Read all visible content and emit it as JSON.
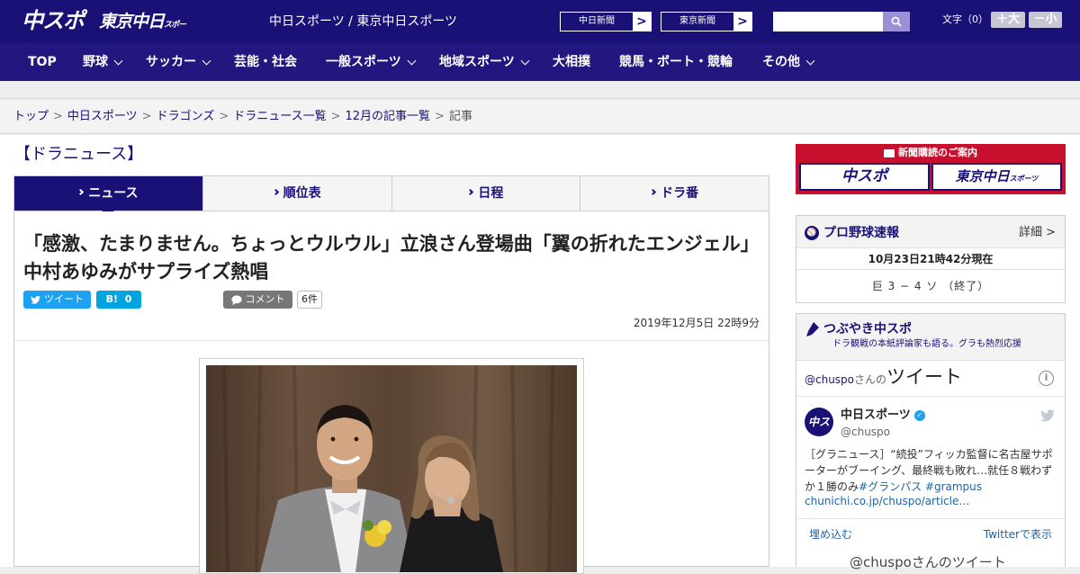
{
  "header": {
    "logo_chunichi": "中スポ",
    "logo_tokyo": "東京中日",
    "logo_tokyo_small": "スポーツ",
    "site_title": "中日スポーツ / 東京中日スポーツ",
    "ext_links": [
      {
        "label": "中日新聞",
        "arrow": ">"
      },
      {
        "label": "東京新聞",
        "arrow": ">"
      }
    ],
    "search_placeholder": "",
    "fontsize_label": "文字（0）",
    "font_larger": "＋大",
    "font_smaller": "－小"
  },
  "nav": [
    {
      "label": "TOP",
      "dropdown": false
    },
    {
      "label": "野球",
      "dropdown": true
    },
    {
      "label": "サッカー",
      "dropdown": true
    },
    {
      "label": "芸能・社会",
      "dropdown": false
    },
    {
      "label": "一般スポーツ",
      "dropdown": true
    },
    {
      "label": "地域スポーツ",
      "dropdown": true
    },
    {
      "label": "大相撲",
      "dropdown": false
    },
    {
      "label": "競馬・ボート・競輪",
      "dropdown": false
    },
    {
      "label": "その他",
      "dropdown": true
    }
  ],
  "breadcrumb": [
    {
      "label": "トップ",
      "link": true
    },
    {
      "label": "中日スポーツ",
      "link": true
    },
    {
      "label": "ドラゴンズ",
      "link": true
    },
    {
      "label": "ドラニュース一覧",
      "link": true
    },
    {
      "label": "12月の記事一覧",
      "link": true
    },
    {
      "label": "記事",
      "link": false
    }
  ],
  "breadcrumb_sep": ">",
  "section_title": "【ドラニュース】",
  "tabs": [
    {
      "label": "ニュース",
      "active": true
    },
    {
      "label": "順位表",
      "active": false
    },
    {
      "label": "日程",
      "active": false
    },
    {
      "label": "ドラ番",
      "active": false
    }
  ],
  "article": {
    "headline": "「感激、たまりません。ちょっとウルウル」立浪さん登場曲「翼の折れたエンジェル」中村あゆみがサプライズ熱唱",
    "tweet_label": "ツイート",
    "hatena_label": "B!",
    "hatena_count": "0",
    "comment_label": "コメント",
    "comment_count": "6件",
    "pubdate": "2019年12月5日 22時9分"
  },
  "sidebar": {
    "ad": {
      "title": "新聞購読のご案内",
      "logo1": "中スポ",
      "logo2": "東京中日",
      "logo2_small": "スポーツ"
    },
    "baseball": {
      "title": "プロ野球速報",
      "more": "詳細 >",
      "time": "10月23日21時42分現在",
      "score": "巨 3 − 4 ソ （終了）"
    },
    "tsubuyaki": {
      "title": "つぶやき中スポ",
      "subtitle": "ドラ観戦の本紙評論家も語る。グラも熱烈応援",
      "timeline_handle": "@chuspo",
      "timeline_san": "さんの",
      "timeline_word": "ツイート",
      "info": "i",
      "account_name": "中日スポーツ",
      "account_handle": "@chuspo",
      "avatar_text": "中スポ",
      "tweet_text": "［グラニュース］“続投”フィッカ監督に名古屋サポーターがブーイング、最終戦も敗れ…就任８戦わずか１勝のみ",
      "tweet_tag1": "#グランパス",
      "tweet_tag2": "#grampus",
      "tweet_link": "chunichi.co.jp/chuspo/article…",
      "embed": "埋め込む",
      "view_on_twitter": "Twitterで表示",
      "bottom_text": "@chuspoさんのツイート"
    }
  },
  "colors": {
    "brand": "#1a1177",
    "ad_red": "#c8102e",
    "twitter": "#1da1f2"
  }
}
